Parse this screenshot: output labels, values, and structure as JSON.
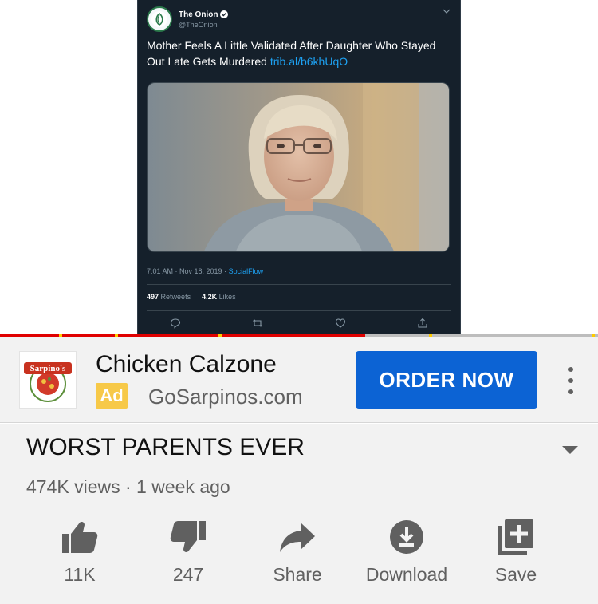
{
  "tweet": {
    "account_name": "The Onion",
    "handle": "@TheOnion",
    "text": "Mother Feels A Little Validated After Daughter Who Stayed Out Late Gets Murdered",
    "link": "trib.al/b6khUqO",
    "timestamp": "7:01 AM · Nov 18, 2019 · ",
    "via": "SocialFlow",
    "retweets_count": "497",
    "retweets_label": "Retweets",
    "likes_count": "4.2K",
    "likes_label": "Likes"
  },
  "player": {
    "progress": 0.61
  },
  "ad": {
    "brand_logo_text": "Sarpino's",
    "title": "Chicken Calzone",
    "badge": "Ad",
    "domain": "GoSarpinos.com",
    "cta": "ORDER NOW"
  },
  "video": {
    "title": "WORST PARENTS EVER",
    "meta": "474K views · 1 week ago"
  },
  "actions": [
    {
      "icon": "thumbs-up-icon",
      "label": "11K"
    },
    {
      "icon": "thumbs-down-icon",
      "label": "247"
    },
    {
      "icon": "share-icon",
      "label": "Share"
    },
    {
      "icon": "download-icon",
      "label": "Download"
    },
    {
      "icon": "save-playlist-icon",
      "label": "Save"
    }
  ],
  "colors": {
    "accent_red": "#e00000",
    "cta_blue": "#0c63d4",
    "ad_badge": "#f7c948",
    "twitter_blue": "#1da1f2"
  }
}
